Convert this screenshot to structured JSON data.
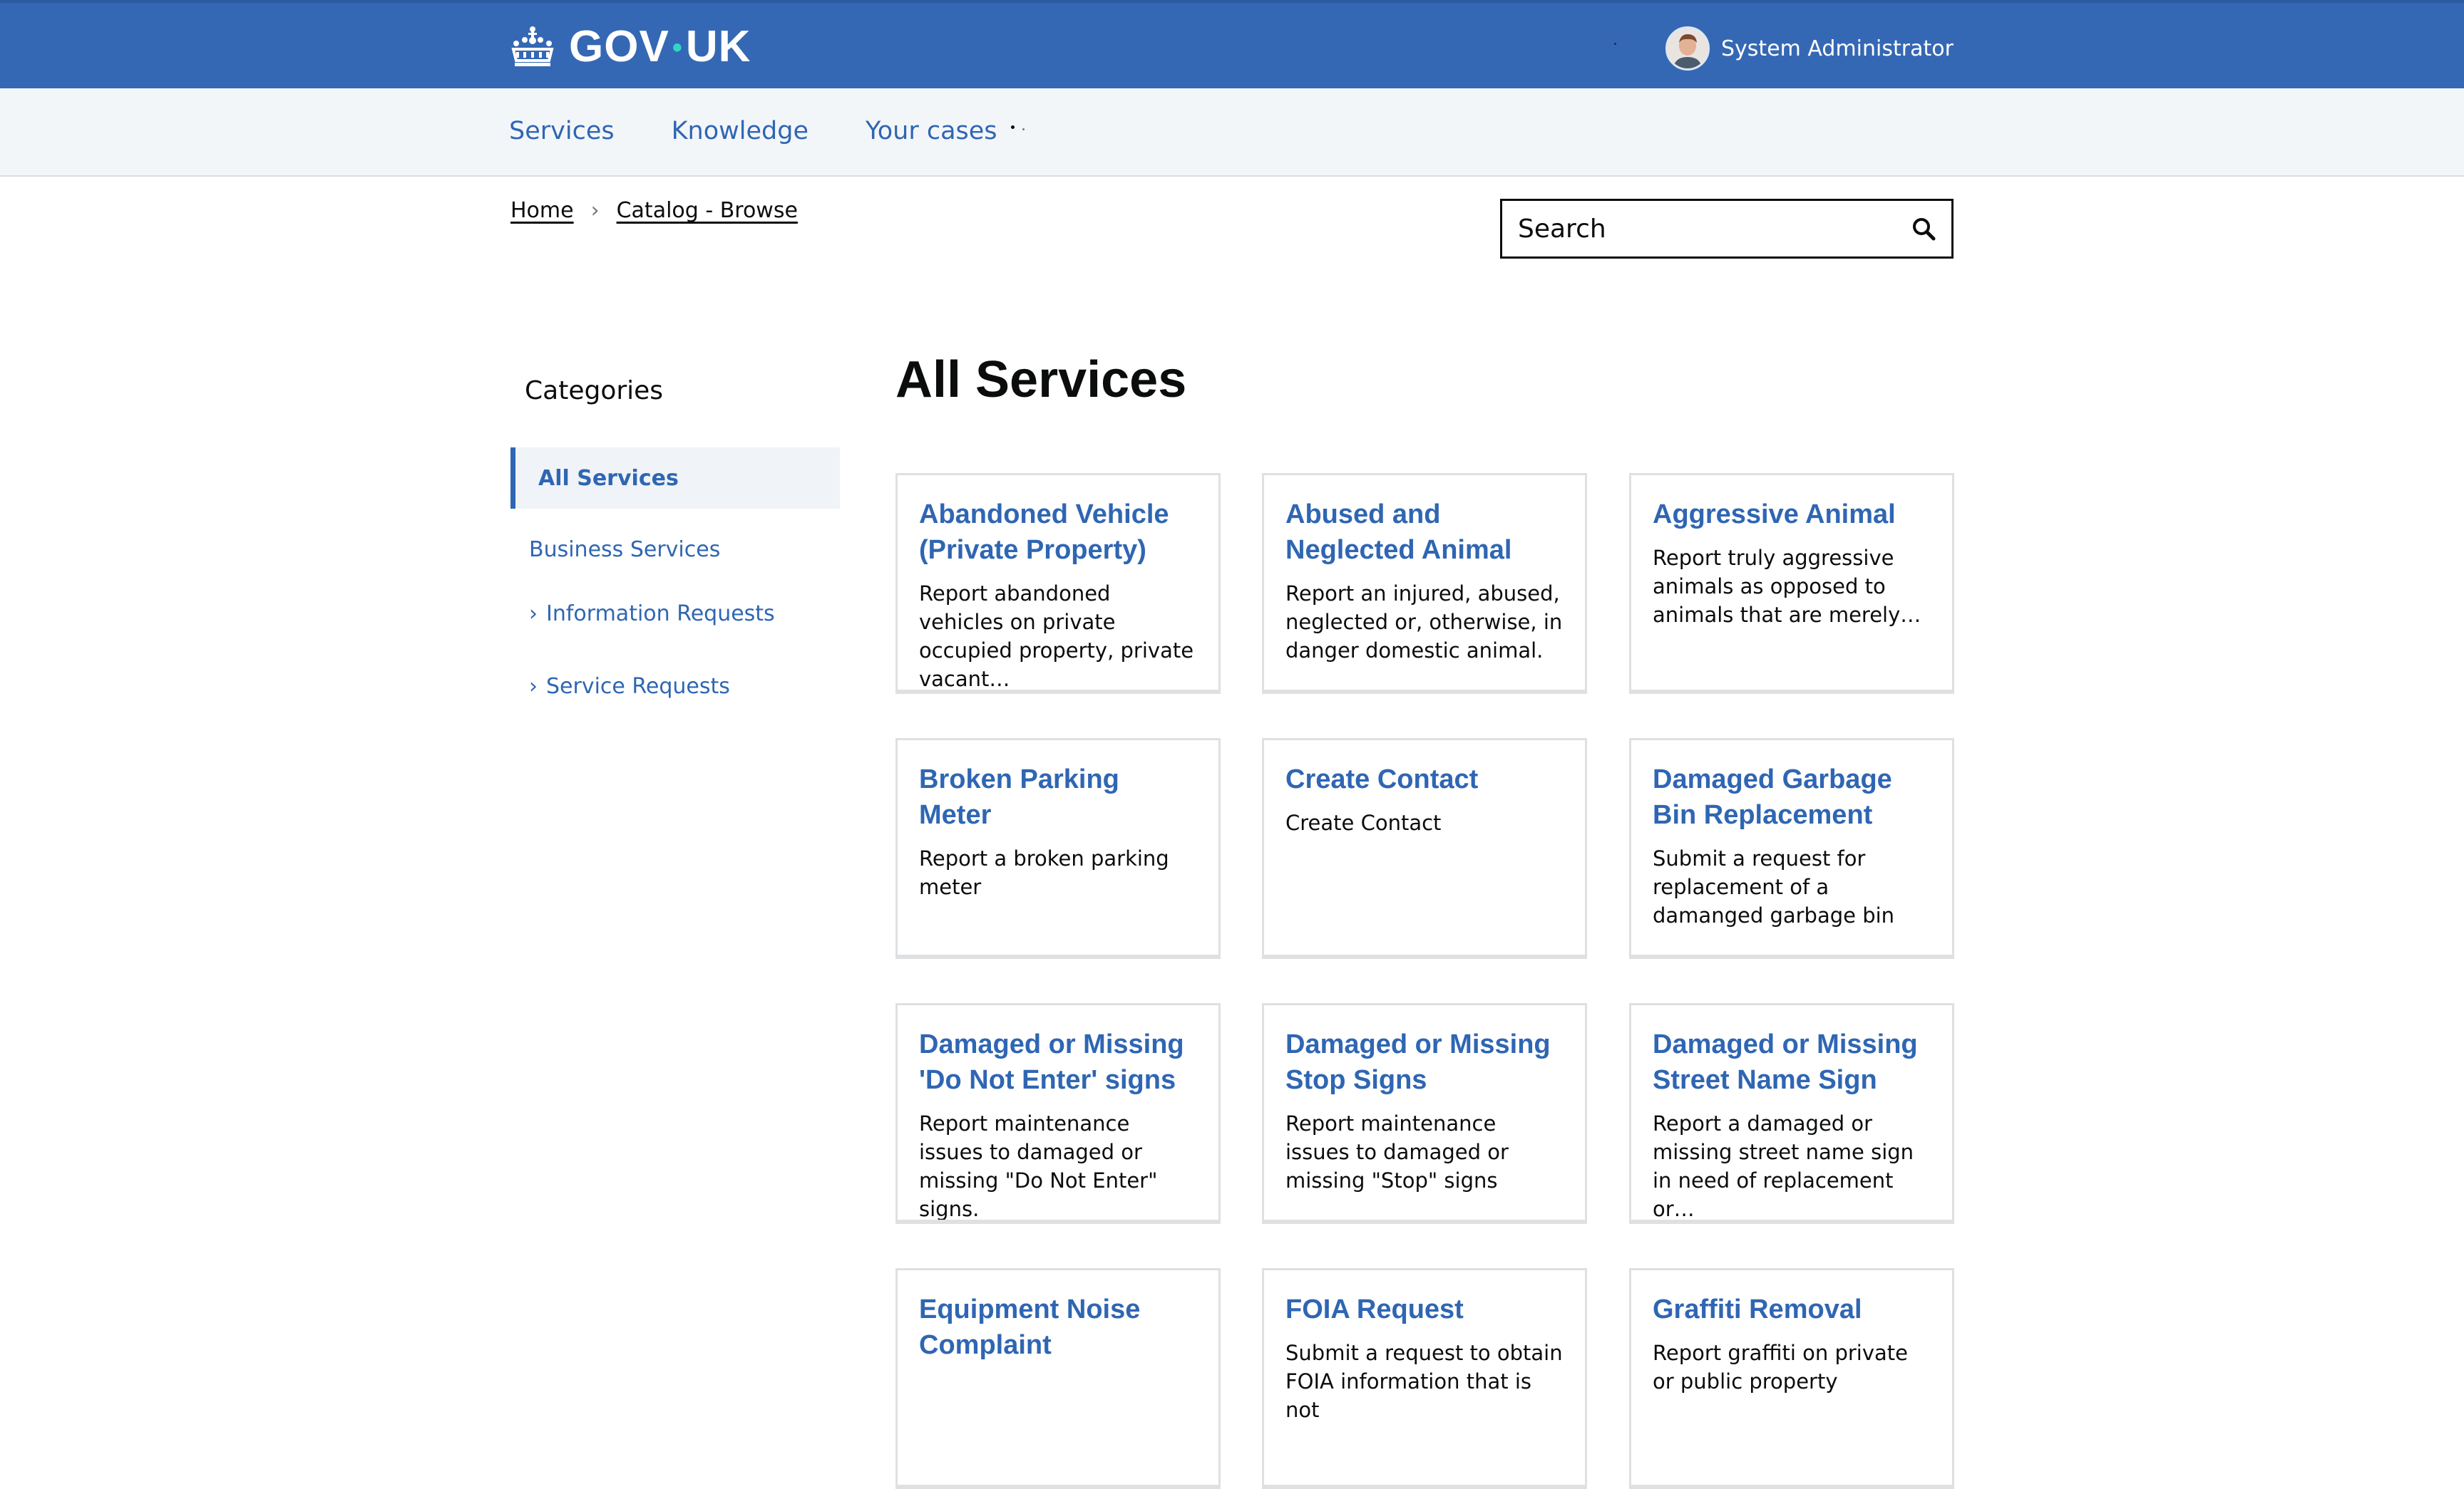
{
  "header": {
    "brand": "GOV",
    "brand_suffix": "UK",
    "user_name": "System Administrator"
  },
  "nav": {
    "items": [
      {
        "label": "Services"
      },
      {
        "label": "Knowledge"
      },
      {
        "label": "Your cases"
      }
    ]
  },
  "breadcrumb": {
    "items": [
      {
        "label": "Home"
      },
      {
        "label": "Catalog - Browse"
      }
    ],
    "separator": "›"
  },
  "search": {
    "placeholder": "Search"
  },
  "sidebar": {
    "heading": "Categories",
    "items": [
      {
        "label": "All Services",
        "active": true
      },
      {
        "label": "Business Services",
        "expandable": false
      },
      {
        "label": "Information Requests",
        "expandable": true
      },
      {
        "label": "Service Requests",
        "expandable": true
      }
    ],
    "chevron": "›"
  },
  "main": {
    "title": "All Services",
    "cards": [
      {
        "title": "Abandoned Vehicle (Private Property)",
        "description": "Report abandoned vehicles on private occupied property, private vacant…"
      },
      {
        "title": "Abused and Neglected Animal",
        "description": "Report an injured, abused, neglected or, otherwise, in danger domestic animal."
      },
      {
        "title": "Aggressive Animal",
        "description": "Report truly aggressive animals as opposed to animals that are merely…"
      },
      {
        "title": "Broken Parking Meter",
        "description": "Report a broken parking meter"
      },
      {
        "title": "Create Contact",
        "description": "Create Contact"
      },
      {
        "title": "Damaged Garbage Bin Replacement",
        "description": "Submit a request for replacement of a damanged garbage bin"
      },
      {
        "title": "Damaged or Missing 'Do Not Enter' signs",
        "description": "Report maintenance issues to damaged or missing \"Do Not Enter\" signs."
      },
      {
        "title": "Damaged or Missing Stop Signs",
        "description": "Report maintenance issues to damaged or missing \"Stop\" signs"
      },
      {
        "title": "Damaged or Missing Street Name Sign",
        "description": "Report a damaged or missing street name sign in need of replacement or…"
      },
      {
        "title": "Equipment Noise Complaint",
        "description": ""
      },
      {
        "title": "FOIA Request",
        "description": "Submit a request to obtain FOIA information that is not"
      },
      {
        "title": "Graffiti Removal",
        "description": "Report graffiti on private or public property"
      }
    ]
  },
  "colors": {
    "header_bg": "#3568b4",
    "link_blue": "#2f66b3",
    "nav_bg": "#f3f6f9"
  }
}
